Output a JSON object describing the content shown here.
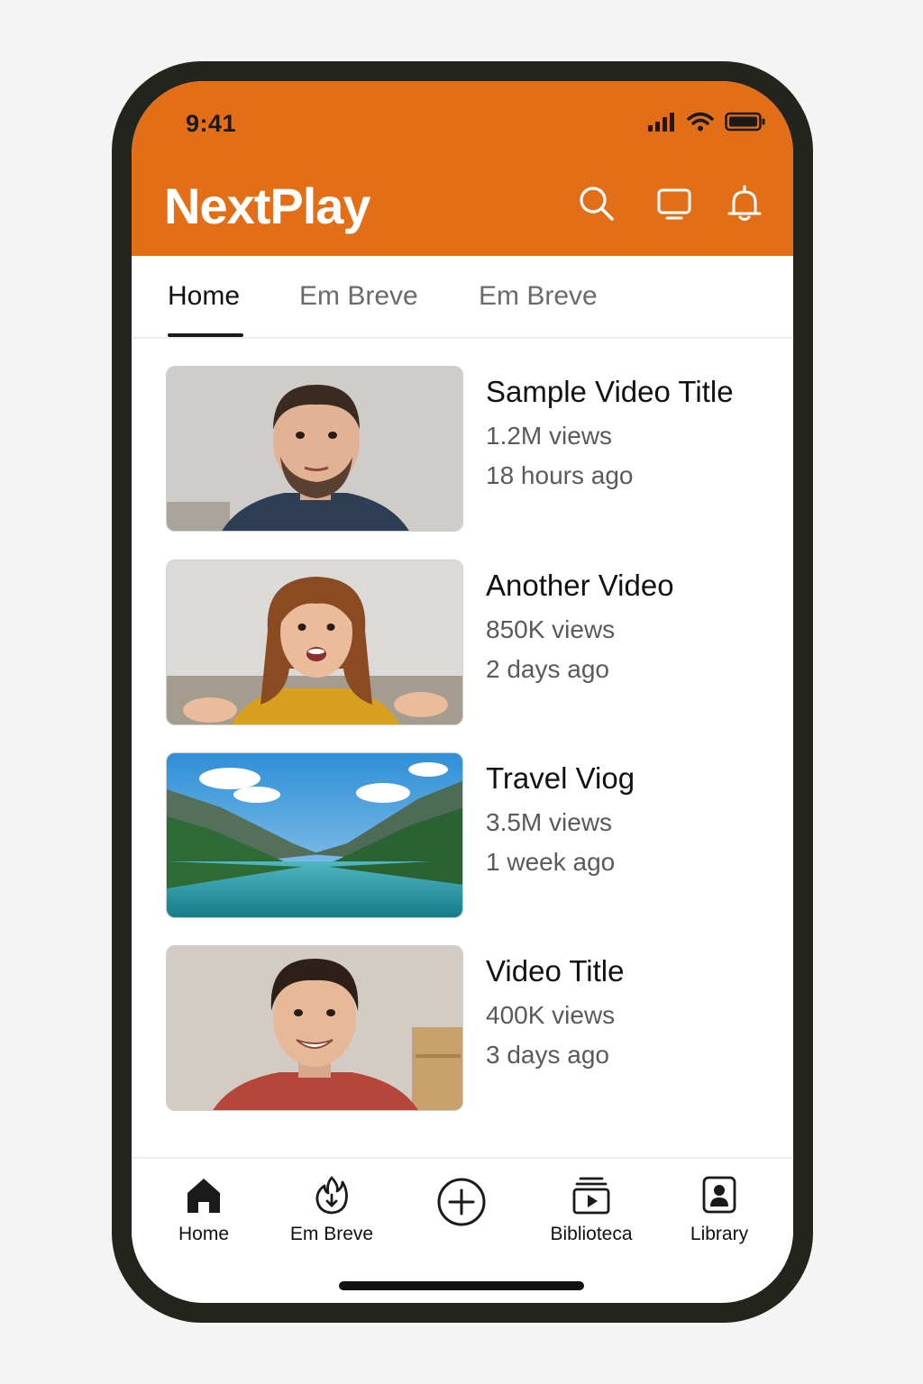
{
  "status_bar": {
    "time": "9:41"
  },
  "header": {
    "app_name": "NextPlay",
    "icons": [
      "search-icon",
      "cast-icon",
      "bell-icon"
    ],
    "brand_color": "#e26f18"
  },
  "tabs": [
    {
      "label": "Home",
      "active": true
    },
    {
      "label": "Em Breve",
      "active": false
    },
    {
      "label": "Em Breve",
      "active": false
    }
  ],
  "videos": [
    {
      "title": "Sample Video Title",
      "views": "1.2M views",
      "age": "18 hours ago",
      "thumbnail": "man-portrait"
    },
    {
      "title": "Another Video",
      "views": "850K views",
      "age": "2 days ago",
      "thumbnail": "woman-portrait"
    },
    {
      "title": "Travel Viog",
      "views": "3.5M views",
      "age": "1 week ago",
      "thumbnail": "mountain-lake"
    },
    {
      "title": "Video Title",
      "views": "400K views",
      "age": "3 days ago",
      "thumbnail": "man-smiling-portrait"
    }
  ],
  "bottom_nav": [
    {
      "label": "Home",
      "icon": "home-icon"
    },
    {
      "label": "Em Breve",
      "icon": "flame-icon"
    },
    {
      "label": "",
      "icon": "add-circle-icon"
    },
    {
      "label": "Biblioteca",
      "icon": "library-play-icon"
    },
    {
      "label": "Library",
      "icon": "account-box-icon"
    }
  ]
}
